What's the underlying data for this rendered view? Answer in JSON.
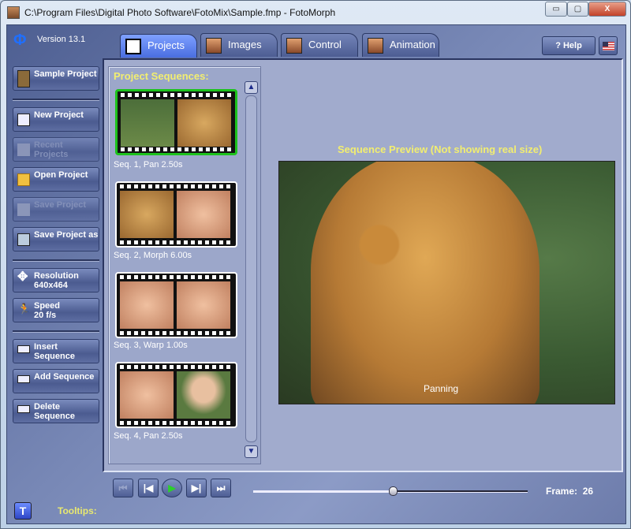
{
  "window": {
    "title": "C:\\Program Files\\Digital Photo Software\\FotoMix\\Sample.fmp - FotoMorph",
    "minimize": "▭",
    "maximize": "▢",
    "close": "X"
  },
  "app": {
    "version": "Version 13.1",
    "logo": "Φ"
  },
  "tabs": [
    {
      "label": "Projects",
      "active": true
    },
    {
      "label": "Images"
    },
    {
      "label": "Control"
    },
    {
      "label": "Animation"
    }
  ],
  "header": {
    "help": "? Help"
  },
  "sidebar": {
    "sample": "Sample Project",
    "new": "New Project",
    "recent": "Recent Projects",
    "open": "Open Project",
    "save": "Save Project",
    "save_as": "Save Project as",
    "resolution": "Resolution",
    "resolution_value": "640x464",
    "speed": "Speed",
    "speed_value": "20 f/s",
    "insert": "Insert Sequence",
    "add": "Add Sequence",
    "delete": "Delete Sequence"
  },
  "sequences": {
    "title": "Project Sequences:",
    "items": [
      {
        "caption": "Seq. 1,  Pan 2.50s",
        "selected": true
      },
      {
        "caption": "Seq. 2,  Morph 6.00s"
      },
      {
        "caption": "Seq. 3,  Warp 1.00s"
      },
      {
        "caption": "Seq. 4,  Pan 2.50s"
      }
    ]
  },
  "preview": {
    "title": "Sequence Preview (Not showing real size)",
    "overlay": "Panning"
  },
  "playback": {
    "first": "⏮",
    "prev": "|◀",
    "play": "▶",
    "next": "▶|",
    "last": "⏭",
    "frame_label": "Frame:",
    "frame": "26",
    "position": 0.51
  },
  "footer": {
    "tooltips_button": "T",
    "tooltips_label": "Tooltips:"
  },
  "colors": {
    "accent_yellow": "#f2ee70",
    "selected_green": "#1dc21d",
    "active_tab": "#4a6ee0"
  }
}
